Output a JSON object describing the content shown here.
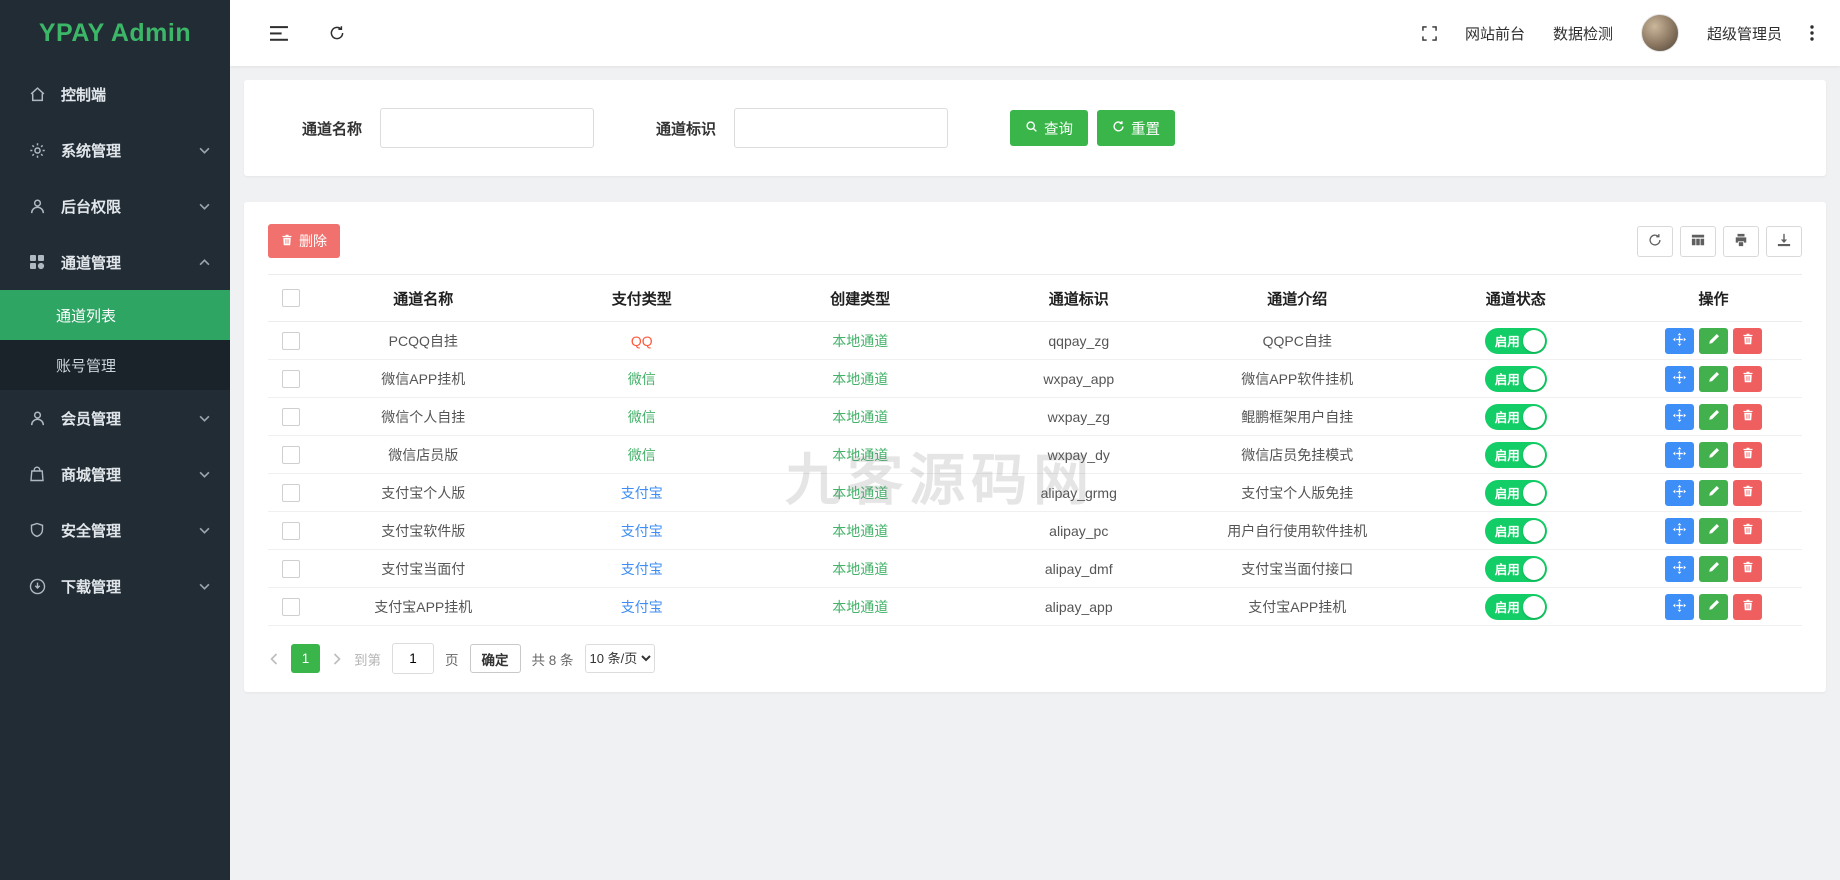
{
  "sidebar": {
    "logo": "YPAY Admin",
    "items": [
      {
        "id": "control",
        "icon": "home-icon",
        "label": "控制端"
      },
      {
        "id": "system",
        "icon": "gear-icon",
        "label": "系统管理",
        "expandable": true
      },
      {
        "id": "permission",
        "icon": "user-icon",
        "label": "后台权限",
        "expandable": true
      },
      {
        "id": "channel",
        "icon": "grid-icon",
        "label": "通道管理",
        "expandable": true,
        "expanded": true,
        "children": [
          {
            "id": "channel-list",
            "label": "通道列表",
            "active": true
          },
          {
            "id": "account",
            "label": "账号管理"
          }
        ]
      },
      {
        "id": "member",
        "icon": "user-icon",
        "label": "会员管理",
        "expandable": true
      },
      {
        "id": "mall",
        "icon": "shop-icon",
        "label": "商城管理",
        "expandable": true
      },
      {
        "id": "security",
        "icon": "shield-icon",
        "label": "安全管理",
        "expandable": true
      },
      {
        "id": "download",
        "icon": "download-icon",
        "label": "下载管理",
        "expandable": true
      }
    ]
  },
  "header": {
    "nav_frontend": "网站前台",
    "nav_data_check": "数据检测",
    "username": "超级管理员"
  },
  "search": {
    "channel_name_label": "通道名称",
    "channel_code_label": "通道标识",
    "query_button": "查询",
    "reset_button": "重置"
  },
  "toolbar": {
    "delete_button": "删除"
  },
  "table": {
    "headers": [
      "通道名称",
      "支付类型",
      "创建类型",
      "通道标识",
      "通道介绍",
      "通道状态",
      "操作"
    ],
    "pay_type_colors": {
      "QQ": "#ff5a3c",
      "微信": "#44b26a",
      "支付宝": "#3d8df5"
    },
    "create_type_color": "#44b26a",
    "toggle_on_color": "#13ce66",
    "rows": [
      {
        "name": "PCQQ自挂",
        "pay_type": "QQ",
        "create_type": "本地通道",
        "code": "qqpay_zg",
        "intro": "QQPC自挂",
        "status": "启用"
      },
      {
        "name": "微信APP挂机",
        "pay_type": "微信",
        "create_type": "本地通道",
        "code": "wxpay_app",
        "intro": "微信APP软件挂机",
        "status": "启用"
      },
      {
        "name": "微信个人自挂",
        "pay_type": "微信",
        "create_type": "本地通道",
        "code": "wxpay_zg",
        "intro": "鲲鹏框架用户自挂",
        "status": "启用"
      },
      {
        "name": "微信店员版",
        "pay_type": "微信",
        "create_type": "本地通道",
        "code": "wxpay_dy",
        "intro": "微信店员免挂模式",
        "status": "启用"
      },
      {
        "name": "支付宝个人版",
        "pay_type": "支付宝",
        "create_type": "本地通道",
        "code": "alipay_grmg",
        "intro": "支付宝个人版免挂",
        "status": "启用"
      },
      {
        "name": "支付宝软件版",
        "pay_type": "支付宝",
        "create_type": "本地通道",
        "code": "alipay_pc",
        "intro": "用户自行使用软件挂机",
        "status": "启用"
      },
      {
        "name": "支付宝当面付",
        "pay_type": "支付宝",
        "create_type": "本地通道",
        "code": "alipay_dmf",
        "intro": "支付宝当面付接口",
        "status": "启用"
      },
      {
        "name": "支付宝APP挂机",
        "pay_type": "支付宝",
        "create_type": "本地通道",
        "code": "alipay_app",
        "intro": "支付宝APP挂机",
        "status": "启用"
      }
    ]
  },
  "pagination": {
    "current_page": "1",
    "goto_label": "到第",
    "goto_value": "1",
    "page_unit": "页",
    "confirm_button": "确定",
    "total_text": "共 8 条",
    "page_size_option": "10 条/页"
  },
  "watermark": "九客源码网",
  "colors": {
    "sidebar_bg": "#222c35",
    "logo_green": "#3cb768",
    "active_menu_green": "#2fa564",
    "button_green": "#39b54a",
    "delete_red": "#f0716d",
    "action_blue": "#3e8ef7",
    "action_green": "#42b04c",
    "action_red": "#f05f5f"
  },
  "icons": [
    "collapse-sidebar-icon",
    "refresh-page-icon",
    "fullscreen-icon",
    "more-menu-icon",
    "search-icon",
    "reset-icon",
    "trash-icon",
    "refresh-table-icon",
    "columns-icon",
    "print-icon",
    "export-icon",
    "move-icon",
    "edit-icon",
    "home-icon",
    "gear-icon",
    "user-icon",
    "grid-icon",
    "shop-icon",
    "shield-icon",
    "download-icon",
    "chevron-down-icon",
    "chevron-up-icon"
  ]
}
